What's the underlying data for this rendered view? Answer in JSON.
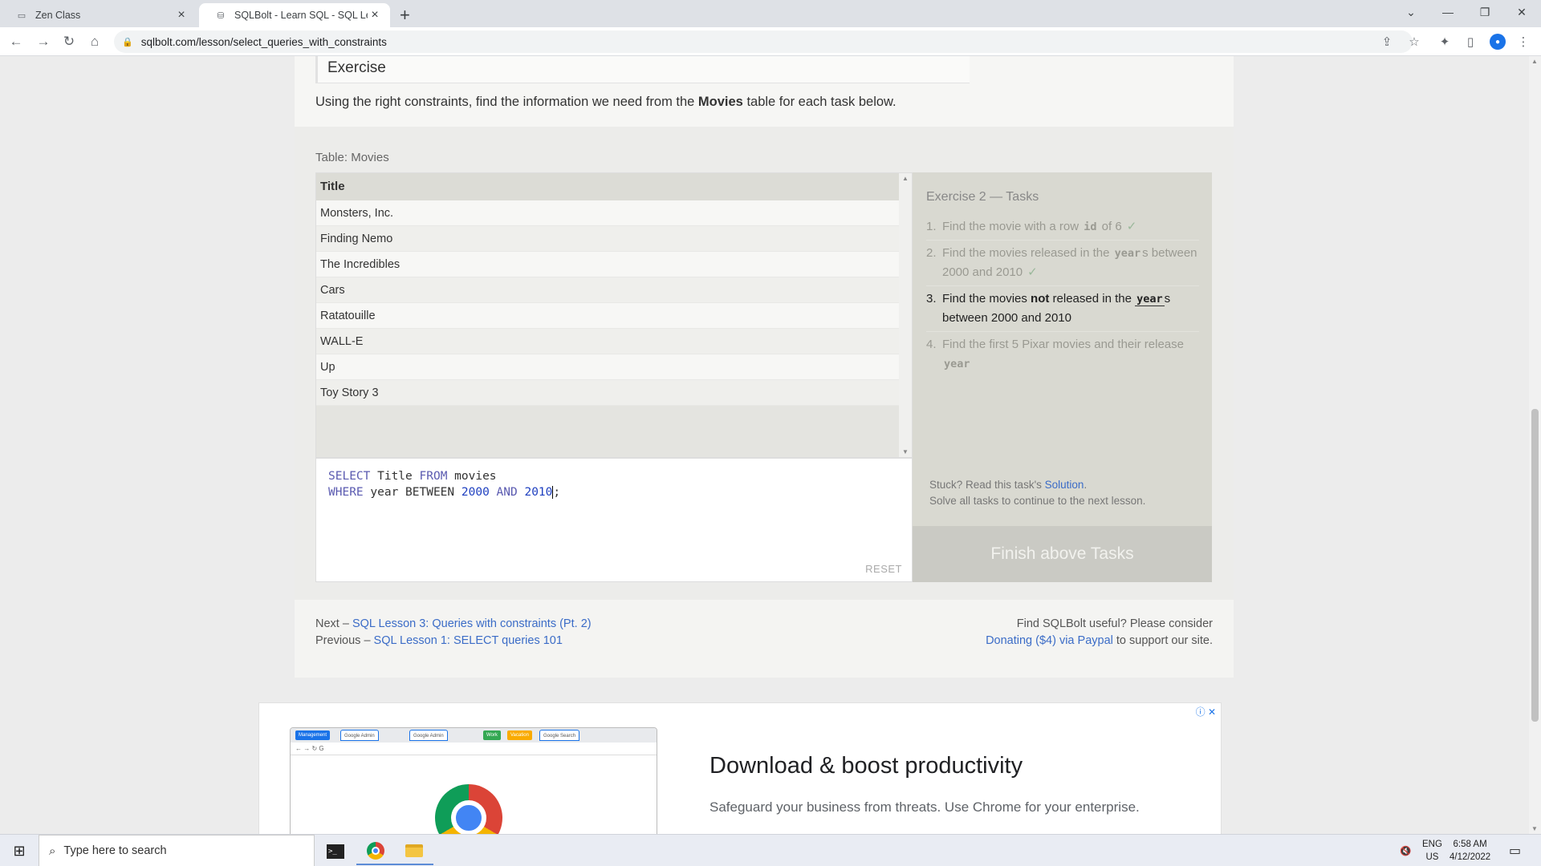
{
  "browser": {
    "tabs": [
      {
        "label": "Zen Class",
        "active": false
      },
      {
        "label": "SQLBolt - Learn SQL - SQL Lesso",
        "active": true
      }
    ],
    "url": "sqlbolt.com/lesson/select_queries_with_constraints"
  },
  "exercise": {
    "heading": "Exercise",
    "intro_before": "Using the right constraints, find the information we need from the ",
    "intro_bold": "Movies",
    "intro_after": " table for each task below."
  },
  "table": {
    "caption": "Table: Movies",
    "header": "Title",
    "rows": [
      "Monsters, Inc.",
      "Finding Nemo",
      "The Incredibles",
      "Cars",
      "Ratatouille",
      "WALL-E",
      "Up",
      "Toy Story 3"
    ]
  },
  "editor": {
    "line1": {
      "kw1": "SELECT",
      "t1": " Title ",
      "kw2": "FROM",
      "t2": " movies"
    },
    "line2": {
      "kw1": "WHERE",
      "t1": " year BETWEEN ",
      "n1": "2000",
      "t2": " ",
      "kw2": "AND",
      "t3": " ",
      "n2": "2010",
      "t4": ";"
    },
    "reset_label": "RESET"
  },
  "tasks": {
    "heading": "Exercise 2 — Tasks",
    "items": [
      {
        "num": "1.",
        "before": "Find the movie with a row ",
        "code": "id",
        "after": " of 6",
        "check": "✓"
      },
      {
        "num": "2.",
        "before": "Find the movies released in the ",
        "code": "year",
        "after": "s between 2000 and 2010",
        "check": "✓"
      },
      {
        "num": "3.",
        "before": "Find the movies ",
        "bold": "not",
        "middle": " released in the ",
        "code": "year",
        "after": "s between 2000 and 2010"
      },
      {
        "num": "4.",
        "before": "Find the first 5 Pixar movies and their release ",
        "code": "year"
      }
    ],
    "stuck_text": "Stuck? Read this task's ",
    "solution_link": "Solution",
    "stuck_end": ".",
    "continue_text": "Solve all tasks to continue to the next lesson.",
    "finish_label": "Finish above Tasks"
  },
  "footer_nav": {
    "next_prefix": "Next – ",
    "next_link": "SQL Lesson 3: Queries with constraints (Pt. 2)",
    "prev_prefix": "Previous – ",
    "prev_link": "SQL Lesson 1: SELECT queries 101",
    "support_line1": "Find SQLBolt useful? Please consider",
    "donate_link": "Donating ($4) via Paypal",
    "support_end": " to support our site."
  },
  "ad": {
    "headline": "Download & boost productivity",
    "subtext": "Safeguard your business from threats. Use Chrome for your enterprise.",
    "mock_chips": [
      "Management",
      "Work",
      "Vacation"
    ],
    "mock_tabs": [
      "Google Admin",
      "Google Admin",
      "Google Search"
    ]
  },
  "taskbar": {
    "search_placeholder": "Type here to search",
    "lang_line1": "ENG",
    "lang_line2": "US",
    "time": "6:58 AM",
    "date": "4/12/2022"
  }
}
